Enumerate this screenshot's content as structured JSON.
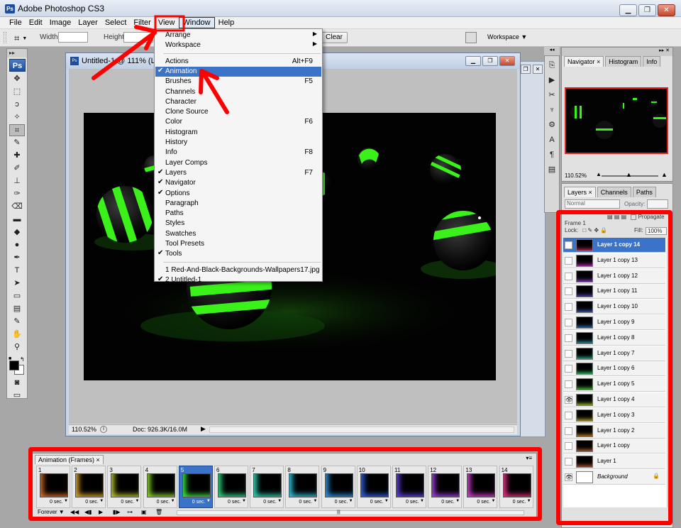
{
  "app": {
    "title": "Adobe Photoshop CS3",
    "icon_label": "Ps",
    "window_controls": {
      "minimize": "▁",
      "restore": "❐",
      "close": "✕"
    }
  },
  "menubar": {
    "items": [
      "File",
      "Edit",
      "Image",
      "Layer",
      "Select",
      "Filter",
      "View",
      "Window",
      "Help"
    ],
    "active": "Window"
  },
  "options_bar": {
    "width_label": "Width:",
    "height_label": "Height:",
    "clear_button": "Clear",
    "workspace_label": "Workspace ▼"
  },
  "tools": {
    "logo": "Ps",
    "icons": [
      "move-icon",
      "marquee-icon",
      "lasso-icon",
      "magic-wand-icon",
      "crop-icon",
      "slice-icon",
      "healing-icon",
      "brush-icon",
      "stamp-icon",
      "history-brush-icon",
      "eraser-icon",
      "gradient-icon",
      "blur-icon",
      "dodge-icon",
      "pen-icon",
      "type-icon",
      "path-select-icon",
      "shape-icon",
      "notes-icon",
      "eyedropper-icon",
      "hand-icon",
      "zoom-icon"
    ],
    "glyphs": [
      "✥",
      "⬚",
      "ↄ",
      "✧",
      "⌗",
      "✎",
      "✚",
      "✐",
      "⊥",
      "✑",
      "⌫",
      "▬",
      "◆",
      "●",
      "✒",
      "T",
      "➤",
      "▭",
      "▤",
      "✎",
      "✋",
      "⚲"
    ]
  },
  "document": {
    "title": "Untitled-1 @ 111% (Layer 1 copy 14, RGB/8)",
    "zoom": "110.52%",
    "doc_size": "Doc: 926.3K/16.0M"
  },
  "window_menu": {
    "items": [
      {
        "label": "Arrange",
        "shortcut": "",
        "checked": false,
        "submenu": true
      },
      {
        "label": "Workspace",
        "shortcut": "",
        "checked": false,
        "submenu": true
      },
      {
        "label": "Actions",
        "shortcut": "Alt+F9",
        "checked": false
      },
      {
        "label": "Animation",
        "shortcut": "",
        "checked": true,
        "highlighted": true
      },
      {
        "label": "Brushes",
        "shortcut": "F5",
        "checked": false
      },
      {
        "label": "Channels",
        "shortcut": "",
        "checked": false
      },
      {
        "label": "Character",
        "shortcut": "",
        "checked": false
      },
      {
        "label": "Clone Source",
        "shortcut": "",
        "checked": false
      },
      {
        "label": "Color",
        "shortcut": "F6",
        "checked": false
      },
      {
        "label": "Histogram",
        "shortcut": "",
        "checked": false
      },
      {
        "label": "History",
        "shortcut": "",
        "checked": false
      },
      {
        "label": "Info",
        "shortcut": "F8",
        "checked": false
      },
      {
        "label": "Layer Comps",
        "shortcut": "",
        "checked": false
      },
      {
        "label": "Layers",
        "shortcut": "F7",
        "checked": true
      },
      {
        "label": "Navigator",
        "shortcut": "",
        "checked": true
      },
      {
        "label": "Options",
        "shortcut": "",
        "checked": true
      },
      {
        "label": "Paragraph",
        "shortcut": "",
        "checked": false
      },
      {
        "label": "Paths",
        "shortcut": "",
        "checked": false
      },
      {
        "label": "Styles",
        "shortcut": "",
        "checked": false
      },
      {
        "label": "Swatches",
        "shortcut": "",
        "checked": false
      },
      {
        "label": "Tool Presets",
        "shortcut": "",
        "checked": false
      },
      {
        "label": "Tools",
        "shortcut": "",
        "checked": true
      },
      {
        "label": "1 Red-And-Black-Backgrounds-Wallpapers17.jpg",
        "shortcut": "",
        "checked": false
      },
      {
        "label": "2 Untitled-1",
        "shortcut": "",
        "checked": true
      }
    ],
    "check_glyph": "✔",
    "submenu_glyph": "▶"
  },
  "navigator": {
    "tabs": [
      "Navigator ×",
      "Histogram",
      "Info"
    ],
    "zoom": "110.52%"
  },
  "layers_panel": {
    "tabs": [
      "Layers ×",
      "Channels",
      "Paths"
    ],
    "blend_mode": "Normal",
    "opacity_label": "Opacity:",
    "opacity_value": "",
    "unify_label": "Propagate Frame 1",
    "lock_label": "Lock:",
    "fill_label": "Fill:",
    "fill_value": "100%",
    "layers": [
      {
        "name": "Layer 1 copy 14",
        "visible": false,
        "selected": true
      },
      {
        "name": "Layer 1 copy 13",
        "visible": false
      },
      {
        "name": "Layer 1 copy 12",
        "visible": false
      },
      {
        "name": "Layer 1 copy 11",
        "visible": false
      },
      {
        "name": "Layer 1 copy 10",
        "visible": false
      },
      {
        "name": "Layer 1 copy 9",
        "visible": false
      },
      {
        "name": "Layer 1 copy 8",
        "visible": false
      },
      {
        "name": "Layer 1 copy 7",
        "visible": false
      },
      {
        "name": "Layer 1 copy 6",
        "visible": false
      },
      {
        "name": "Layer 1 copy 5",
        "visible": false
      },
      {
        "name": "Layer 1 copy 4",
        "visible": true
      },
      {
        "name": "Layer 1 copy 3",
        "visible": false
      },
      {
        "name": "Layer 1 copy 2",
        "visible": false
      },
      {
        "name": "Layer 1 copy",
        "visible": false
      },
      {
        "name": "Layer 1",
        "visible": false
      },
      {
        "name": "Background",
        "visible": true,
        "background": true
      }
    ]
  },
  "animation_panel": {
    "tab": "Animation (Frames) ×",
    "loop": "Forever ▼",
    "controls": [
      "◀◀",
      "◀▮",
      "▶",
      "▮▶",
      "⊶",
      "▣",
      "🗑"
    ],
    "frames": [
      {
        "n": "1",
        "delay": "0 sec.",
        "color": "#d46a2a"
      },
      {
        "n": "2",
        "delay": "0 sec.",
        "color": "#d8a22a"
      },
      {
        "n": "3",
        "delay": "0 sec.",
        "color": "#b8c22a"
      },
      {
        "n": "4",
        "delay": "0 sec.",
        "color": "#8ad030"
      },
      {
        "n": "5",
        "delay": "0 sec.",
        "color": "#3fe040",
        "selected": true
      },
      {
        "n": "6",
        "delay": "0 sec.",
        "color": "#30d080"
      },
      {
        "n": "7",
        "delay": "0 sec.",
        "color": "#30d0b0"
      },
      {
        "n": "8",
        "delay": "0 sec.",
        "color": "#30c0d8"
      },
      {
        "n": "9",
        "delay": "0 sec.",
        "color": "#3090e0"
      },
      {
        "n": "10",
        "delay": "0 sec.",
        "color": "#3060e0"
      },
      {
        "n": "11",
        "delay": "0 sec.",
        "color": "#6040e0"
      },
      {
        "n": "12",
        "delay": "0 sec.",
        "color": "#a040e0"
      },
      {
        "n": "13",
        "delay": "0 sec.",
        "color": "#d040d0"
      },
      {
        "n": "14",
        "delay": "0 sec.",
        "color": "#e03080"
      }
    ]
  },
  "colors": {
    "annotation_red": "#ff0000",
    "selection_blue": "#3b73c8",
    "sphere_green": "#39ff14"
  }
}
